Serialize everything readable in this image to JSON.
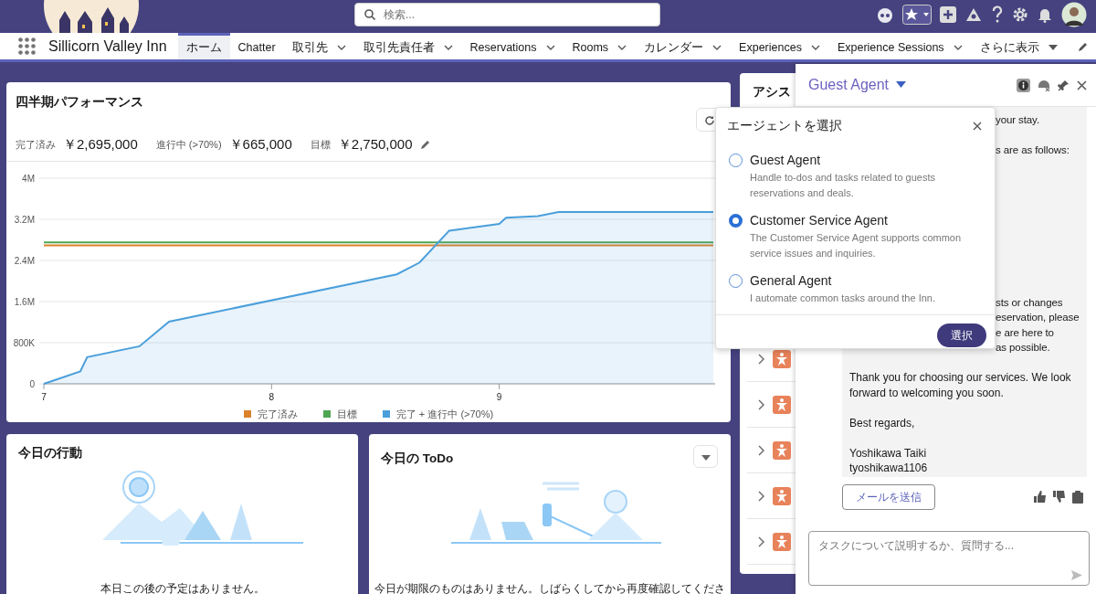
{
  "header": {
    "search": {
      "placeholder": "検索..."
    }
  },
  "nav": {
    "app_name": "Sillicorn Valley Inn",
    "tabs": [
      {
        "label": "ホーム",
        "selected": true,
        "kind": "plain"
      },
      {
        "label": "Chatter",
        "selected": false,
        "kind": "plain"
      },
      {
        "label": "取引先",
        "selected": false,
        "kind": "menu"
      },
      {
        "label": "取引先責任者",
        "selected": false,
        "kind": "menu"
      },
      {
        "label": "Reservations",
        "selected": false,
        "kind": "menu"
      },
      {
        "label": "Rooms",
        "selected": false,
        "kind": "menu"
      },
      {
        "label": "カレンダー",
        "selected": false,
        "kind": "menu"
      },
      {
        "label": "Experiences",
        "selected": false,
        "kind": "menu"
      },
      {
        "label": "Experience Sessions",
        "selected": false,
        "kind": "menu"
      },
      {
        "label": "さらに表示",
        "selected": false,
        "kind": "more"
      }
    ]
  },
  "performance": {
    "title": "四半期パフォーマンス",
    "metrics": [
      {
        "label": "完了済み",
        "value": "￥2,695,000"
      },
      {
        "label": "進行中 (>70%)",
        "value": "￥665,000"
      },
      {
        "label": "目標",
        "value": "￥2,750,000"
      }
    ],
    "target_editable": true,
    "chart_data": {
      "type": "line",
      "grid": true,
      "x": [
        7,
        7.16,
        7.19,
        7.42,
        7.55,
        8.55,
        8.65,
        8.78,
        9,
        9.03,
        9.17,
        9.26,
        9.94
      ],
      "series": [
        {
          "name": "完了済み",
          "color": "#d9822b",
          "values": [
            2695000,
            2695000,
            2695000,
            2695000,
            2695000,
            2695000,
            2695000,
            2695000,
            2695000,
            2695000,
            2695000,
            2695000,
            2695000
          ]
        },
        {
          "name": "目標",
          "color": "#4ea653",
          "values": [
            2750000,
            2750000,
            2750000,
            2750000,
            2750000,
            2750000,
            2750000,
            2750000,
            2750000,
            2750000,
            2750000,
            2750000,
            2750000
          ]
        },
        {
          "name": "完了 + 進行中 (>70%)",
          "color": "#4a9fdb",
          "values": [
            0,
            240000,
            520000,
            730000,
            1210000,
            2130000,
            2360000,
            2980000,
            3110000,
            3230000,
            3260000,
            3340000,
            3340000
          ]
        }
      ],
      "xlim": [
        7,
        9.94
      ],
      "ylim": [
        0,
        4000000
      ],
      "xticks": [
        7,
        8,
        9
      ],
      "yticks": [
        {
          "value": 0,
          "label": "0"
        },
        {
          "value": 800000,
          "label": "800K"
        },
        {
          "value": 1600000,
          "label": "1.6M"
        },
        {
          "value": 2400000,
          "label": "2.4M"
        },
        {
          "value": 3200000,
          "label": "3.2M"
        },
        {
          "value": 4000000,
          "label": "4M"
        }
      ]
    }
  },
  "assistant_card": {
    "title": "アシス",
    "rows": [
      {
        "expanded": false
      },
      {
        "expanded": false
      },
      {
        "expanded": false
      },
      {
        "expanded": false
      },
      {
        "expanded": false
      }
    ]
  },
  "agent_panel": {
    "agent": "Guest Agent",
    "covered_paragraphs": [
      [
        "your stay."
      ],
      [
        "s are as follows:"
      ],
      [
        "sts or changes",
        "eservation, please",
        "e are here to",
        "as possible."
      ]
    ],
    "paragraphs": [
      [
        "Thank you for choosing our services. We look forward to welcoming you soon."
      ],
      [
        "Best regards,"
      ],
      [
        "Yoshikawa Taiki",
        "tyoshikawa1106"
      ]
    ],
    "action": "メールを送信",
    "input": {
      "placeholder": "タスクについて説明するか、質問する..."
    }
  },
  "agent_picker": {
    "title": "エージェントを選択",
    "options": [
      {
        "name": "Guest Agent",
        "description": "Handle to-dos and tasks related to guests reservations and deals.",
        "selected": false
      },
      {
        "name": "Customer Service Agent",
        "description": "The Customer Service Agent supports common service issues and inquiries.",
        "selected": true
      },
      {
        "name": "General Agent",
        "description": "I automate common tasks around the Inn.",
        "selected": false
      }
    ],
    "button": "選択"
  },
  "todays_events": {
    "title": "今日の行動",
    "message": "本日この後の予定はありません。"
  },
  "todays_todos": {
    "title": "今日の ToDo",
    "message": "今日が期限のものはありません。しばらくしてから再度確認してくださ"
  }
}
